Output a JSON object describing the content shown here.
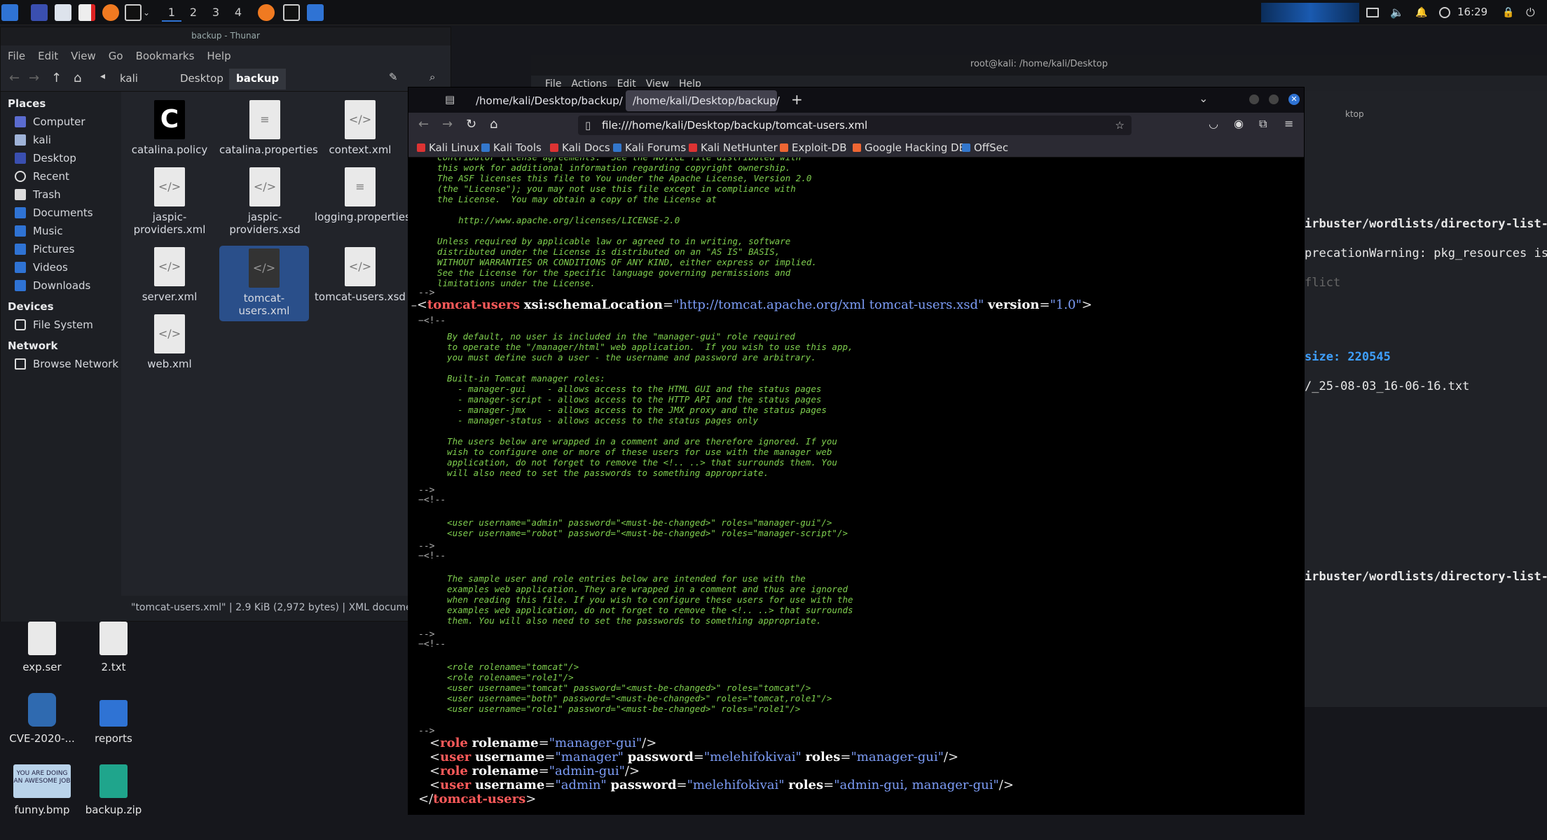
{
  "panel": {
    "workspaces": [
      "1",
      "2",
      "3",
      "4"
    ],
    "clock": "16:29"
  },
  "desktop": {
    "icons": [
      {
        "label": "exp.ser"
      },
      {
        "label": "2.txt"
      },
      {
        "label": "CVE-2020-..."
      },
      {
        "label": "reports"
      },
      {
        "label": "funny.bmp"
      },
      {
        "label": "backup.zip"
      }
    ],
    "funny_image_text": "YOU ARE DOING AN AWESOME JOB"
  },
  "terminal": {
    "title": "root@kali: /home/kali/Desktop",
    "menu": [
      "File",
      "Actions",
      "Edit",
      "View",
      "Help"
    ],
    "partial_title": "ktop",
    "lines": [
      "irbuster/wordlists/directory-list-",
      "precationWarning: pkg_resources is",
      "flict",
      "size: 220545",
      "/_25-08-03_16-06-16.txt",
      "irbuster/wordlists/directory-list-"
    ]
  },
  "thunar": {
    "title": "backup - Thunar",
    "menu": [
      "File",
      "Edit",
      "View",
      "Go",
      "Bookmarks",
      "Help"
    ],
    "path": [
      "kali",
      "Desktop",
      "backup"
    ],
    "places_header": "Places",
    "places": [
      "Computer",
      "kali",
      "Desktop",
      "Recent",
      "Trash",
      "Documents",
      "Music",
      "Pictures",
      "Videos",
      "Downloads"
    ],
    "devices_header": "Devices",
    "devices": [
      "File System"
    ],
    "network_header": "Network",
    "network": [
      "Browse Network"
    ],
    "files": [
      {
        "name": "catalina.policy"
      },
      {
        "name": "catalina.properties"
      },
      {
        "name": "context.xml"
      },
      {
        "name": "jaspic-providers.xml"
      },
      {
        "name": "jaspic-providers.xsd"
      },
      {
        "name": "logging.properties"
      },
      {
        "name": "server.xml"
      },
      {
        "name": "tomcat-users.xml"
      },
      {
        "name": "tomcat-users.xsd"
      },
      {
        "name": "web.xml"
      }
    ],
    "status": "\"tomcat-users.xml\" | 2.9 KiB (2,972 bytes) | XML document"
  },
  "firefox": {
    "tabs": [
      "/home/kali/Desktop/backup/",
      "/home/kali/Desktop/backup/"
    ],
    "url": "file:///home/kali/Desktop/backup/tomcat-users.xml",
    "bookmarks": [
      "Kali Linux",
      "Kali Tools",
      "Kali Docs",
      "Kali Forums",
      "Kali NetHunter",
      "Exploit-DB",
      "Google Hacking DB",
      "OffSec"
    ],
    "comment1": "  contributor license agreements.  See the NOTICE file distributed with\n  this work for additional information regarding copyright ownership.\n  The ASF licenses this file to You under the Apache License, Version 2.0\n  (the \"License\"); you may not use this file except in compliance with\n  the License.  You may obtain a copy of the License at\n\n      http://www.apache.org/licenses/LICENSE-2.0\n\n  Unless required by applicable law or agreed to in writing, software\n  distributed under the License is distributed on an \"AS IS\" BASIS,\n  WITHOUT WARRANTIES OR CONDITIONS OF ANY KIND, either express or implied.\n  See the License for the specific language governing permissions and\n  limitations under the License.",
    "comment1_end": "-->",
    "root_open": {
      "tag": "tomcat-users",
      "a1": "xsi:schemaLocation",
      "v1": "\"http://tomcat.apache.org/xml tomcat-users.xsd\"",
      "a2": "version",
      "v2": "\"1.0\""
    },
    "comment2": "  By default, no user is included in the \"manager-gui\" role required\n  to operate the \"/manager/html\" web application.  If you wish to use this app,\n  you must define such a user - the username and password are arbitrary.\n\n  Built-in Tomcat manager roles:\n    - manager-gui    - allows access to the HTML GUI and the status pages\n    - manager-script - allows access to the HTTP API and the status pages\n    - manager-jmx    - allows access to the JMX proxy and the status pages\n    - manager-status - allows access to the status pages only\n\n  The users below are wrapped in a comment and are therefore ignored. If you\n  wish to configure one or more of these users for use with the manager web\n  application, do not forget to remove the <!.. ..> that surrounds them. You\n  will also need to set the passwords to something appropriate.",
    "comment3": "  <user username=\"admin\" password=\"<must-be-changed>\" roles=\"manager-gui\"/>\n  <user username=\"robot\" password=\"<must-be-changed>\" roles=\"manager-script\"/>",
    "comment4": "  The sample user and role entries below are intended for use with the\n  examples web application. They are wrapped in a comment and thus are ignored\n  when reading this file. If you wish to configure these users for use with the\n  examples web application, do not forget to remove the <!.. ..> that surrounds\n  them. You will also need to set the passwords to something appropriate.",
    "comment5": "  <role rolename=\"tomcat\"/>\n  <role rolename=\"role1\"/>\n  <user username=\"tomcat\" password=\"<must-be-changed>\" roles=\"tomcat\"/>\n  <user username=\"both\" password=\"<must-be-changed>\" roles=\"tomcat,role1\"/>\n  <user username=\"role1\" password=\"<must-be-changed>\" roles=\"role1\"/>",
    "comment_open": "<!--",
    "comment_close": "-->",
    "elements": [
      {
        "tag": "role",
        "attrs": [
          [
            "rolename",
            "\"manager-gui\""
          ]
        ]
      },
      {
        "tag": "user",
        "attrs": [
          [
            "username",
            "\"manager\""
          ],
          [
            "password",
            "\"melehifokivai\""
          ],
          [
            "roles",
            "\"manager-gui\""
          ]
        ]
      },
      {
        "tag": "role",
        "attrs": [
          [
            "rolename",
            "\"admin-gui\""
          ]
        ]
      },
      {
        "tag": "user",
        "attrs": [
          [
            "username",
            "\"admin\""
          ],
          [
            "password",
            "\"melehifokivai\""
          ],
          [
            "roles",
            "\"admin-gui, manager-gui\""
          ]
        ]
      }
    ],
    "root_close": "tomcat-users"
  }
}
